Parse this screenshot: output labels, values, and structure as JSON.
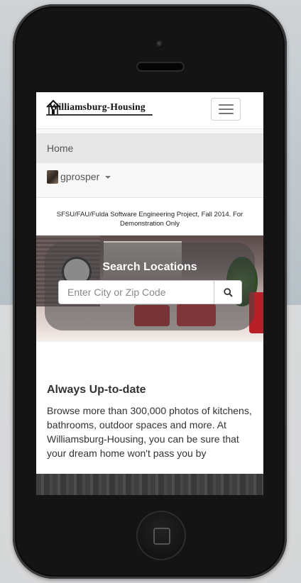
{
  "brand": {
    "logo_text": "Williamsburg-Housing"
  },
  "nav": {
    "home_label": "Home",
    "user_name": "gprosper"
  },
  "notice": "SFSU/FAU/Fulda Software Engineering Project, Fall 2014. For Demonstration Only",
  "search": {
    "title": "Search Locations",
    "placeholder": "Enter City or Zip Code"
  },
  "feature": {
    "heading": "Always Up-to-date",
    "text": "Browse more than 300,000 photos of kitchens, bathrooms, outdoor spaces and more. At Williamsburg-Housing, you can be sure that your dream home won't pass you by"
  }
}
